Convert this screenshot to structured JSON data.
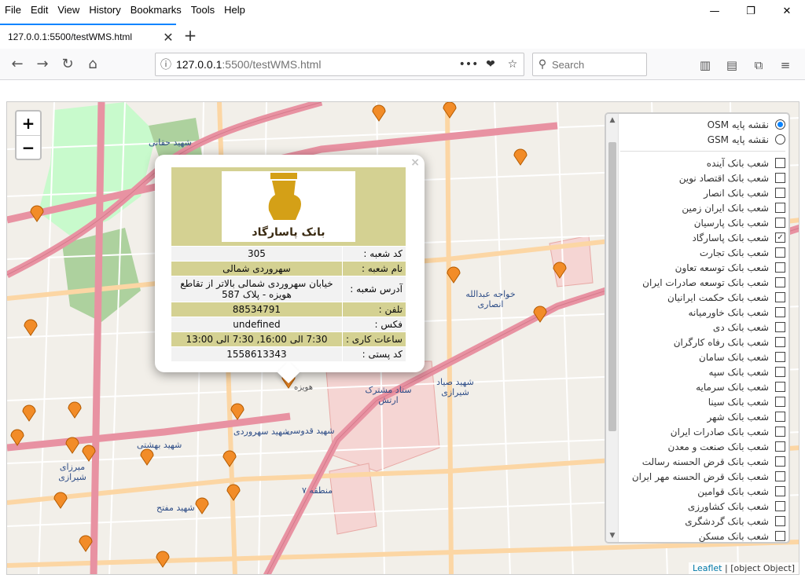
{
  "menubar": {
    "items": [
      "File",
      "Edit",
      "View",
      "History",
      "Bookmarks",
      "Tools",
      "Help"
    ]
  },
  "window_controls": {
    "minimize": "—",
    "restore": "❐",
    "close": "✕"
  },
  "tab": {
    "title": "127.0.0.1:5500/testWMS.html",
    "close": "✕",
    "new_tab": "+"
  },
  "navbar": {
    "back": "←",
    "forward": "→",
    "reload": "↻",
    "home": "⌂",
    "url_host": "127.0.0.1",
    "url_rest": ":5500/testWMS.html",
    "page_actions": "•••",
    "pocket": "❤",
    "bookmark": "☆",
    "search_placeholder": "Search",
    "library": "▥",
    "sidebar": "▤",
    "sync": "⧉",
    "menu": "≡"
  },
  "map": {
    "zoom_in": "+",
    "zoom_out": "−",
    "attribution_link": "Leaflet",
    "attribution_sep": " | ",
    "attribution_text": "[object Object]",
    "labels": [
      {
        "text": "شهید حقانی"
      },
      {
        "text": "منطقه ۷"
      },
      {
        "text": "ستاد مشترک ارتش"
      },
      {
        "text": "شهید صیاد شیرازی"
      },
      {
        "text": "شهید قدوسی"
      },
      {
        "text": "شهید سهروردی"
      },
      {
        "text": "خواجه عبدالله انصاری"
      },
      {
        "text": "شهید بهشتی"
      },
      {
        "text": "شهید مفتح"
      },
      {
        "text": "میرزای شیرازی"
      },
      {
        "text": "هویزه"
      }
    ]
  },
  "popup": {
    "close": "×",
    "logo_text": "بانک پاسارگاد",
    "rows": [
      {
        "key": "کد شعبه :",
        "value": "305"
      },
      {
        "key": "نام شعبه :",
        "value": "سهروردی شمالی"
      },
      {
        "key": "آدرس شعبه :",
        "value": "خیابان سهروردی شمالی بالاتر از تقاطع هویزه - پلاک 587"
      },
      {
        "key": "تلفن :",
        "value": "88534791"
      },
      {
        "key": "فکس :",
        "value": "undefined"
      },
      {
        "key": "ساعات کاری :",
        "value": "7:30 الی 16:00, 7:30 الی 13:00"
      },
      {
        "key": "کد پستی :",
        "value": "1558613343"
      }
    ]
  },
  "layers": {
    "base": [
      {
        "label": "نقشه پایه OSM",
        "selected": true
      },
      {
        "label": "نقشه پایه GSM",
        "selected": false
      }
    ],
    "overlays": [
      {
        "label": "شعب بانک آینده",
        "checked": false
      },
      {
        "label": "شعب بانک اقتصاد نوین",
        "checked": false
      },
      {
        "label": "شعب بانک انصار",
        "checked": false
      },
      {
        "label": "شعب بانک ایران زمین",
        "checked": false
      },
      {
        "label": "شعب بانک پارسیان",
        "checked": false
      },
      {
        "label": "شعب بانک پاسارگاد",
        "checked": true
      },
      {
        "label": "شعب بانک تجارت",
        "checked": false
      },
      {
        "label": "شعب بانک توسعه تعاون",
        "checked": false
      },
      {
        "label": "شعب بانک توسعه صادرات ایران",
        "checked": false
      },
      {
        "label": "شعب بانک حکمت ایرانیان",
        "checked": false
      },
      {
        "label": "شعب بانک خاورمیانه",
        "checked": false
      },
      {
        "label": "شعب بانک دی",
        "checked": false
      },
      {
        "label": "شعب بانک رفاه کارگران",
        "checked": false
      },
      {
        "label": "شعب بانک سامان",
        "checked": false
      },
      {
        "label": "شعب بانک سپه",
        "checked": false
      },
      {
        "label": "شعب بانک سرمایه",
        "checked": false
      },
      {
        "label": "شعب بانک سینا",
        "checked": false
      },
      {
        "label": "شعب بانک شهر",
        "checked": false
      },
      {
        "label": "شعب بانک صادرات ایران",
        "checked": false
      },
      {
        "label": "شعب بانک صنعت و معدن",
        "checked": false
      },
      {
        "label": "شعب بانک قرض الحسنه رسالت",
        "checked": false
      },
      {
        "label": "شعب بانک قرض الحسنه مهر ایران",
        "checked": false
      },
      {
        "label": "شعب بانک قوامین",
        "checked": false
      },
      {
        "label": "شعب بانک کشاورزی",
        "checked": false
      },
      {
        "label": "شعب بانک گردشگری",
        "checked": false
      },
      {
        "label": "شعب بانک مسکن",
        "checked": false
      }
    ]
  },
  "colors": {
    "accent": "#0a84ff",
    "popup_row": "#d4d192",
    "marker": "#f28c28",
    "highway": "#e892a2",
    "primary_road": "#fcd6a4",
    "park": "#c8facc",
    "military": "#f5d5d3",
    "bank_logo_gold": "#d4a017"
  }
}
